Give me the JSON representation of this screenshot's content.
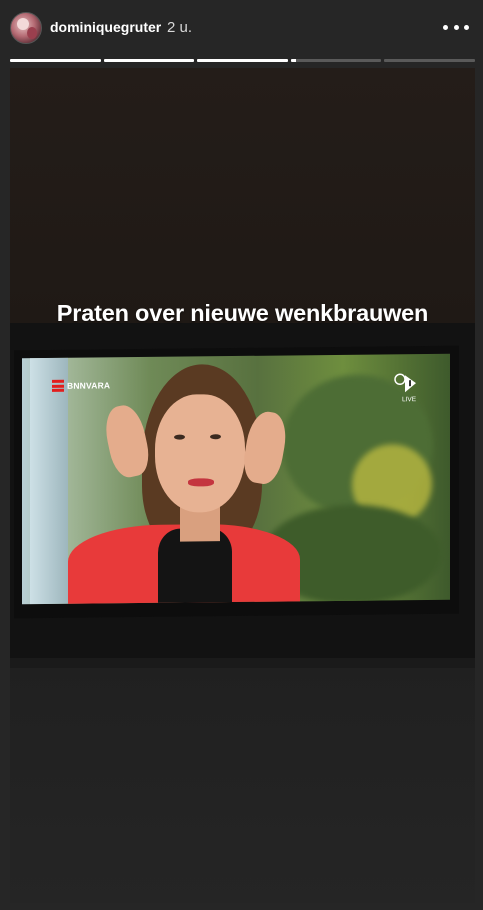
{
  "header": {
    "username": "dominiquegruter",
    "time": "2 u.",
    "avatar_icon": "profile-photo",
    "more_icon": "more-horizontal-icon"
  },
  "progress": {
    "segments": 5,
    "filled": [
      1,
      1,
      1,
      0.06,
      0
    ]
  },
  "story": {
    "caption": "Praten over nieuwe wenkbrauwen",
    "tv": {
      "broadcaster_label": "BNNVARA",
      "channel_logo": "npo-1-logo",
      "channel_live": "LIVE"
    }
  },
  "colors": {
    "background": "#262626",
    "progress_active": "#ffffff",
    "progress_inactive": "#5a5a5a",
    "brand_red": "#e21d1d"
  }
}
